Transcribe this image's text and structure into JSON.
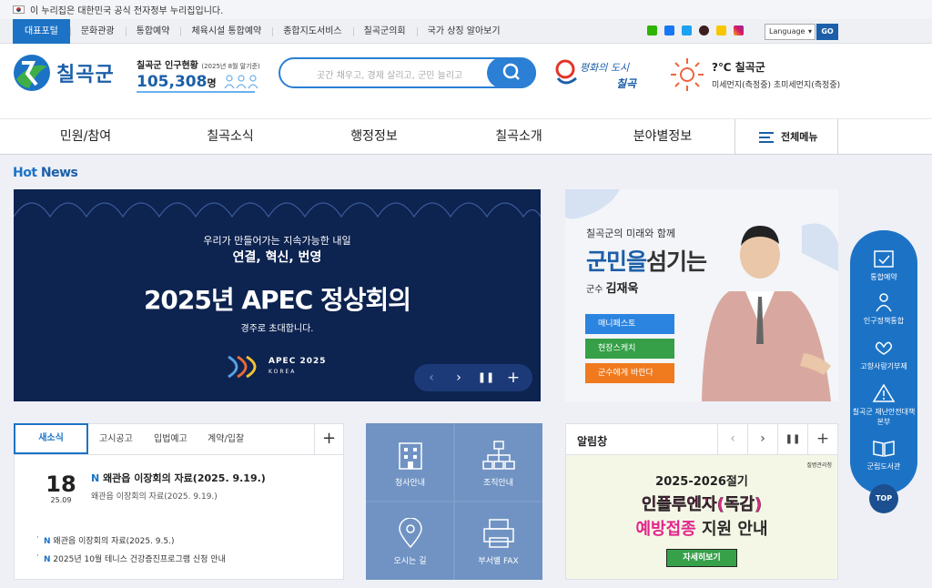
{
  "gov_bar": {
    "text": "이 누리집은 대한민국 공식 전자정부 누리집입니다."
  },
  "top_nav": {
    "items": [
      "대표포털",
      "문화관광",
      "통합예약",
      "체육시설 통합예약",
      "종합지도서비스",
      "칠곡군의회",
      "국가 상징 알아보기"
    ],
    "language_label": "Language",
    "go_label": "GO"
  },
  "header": {
    "logo_text": "칠곡군",
    "population_label": "칠곡군 인구현황",
    "population_note": "(2025년 8월 말기준)",
    "population_value": "105,308",
    "population_unit": "명",
    "search_placeholder": "곳간 채우고, 경제 살리고, 군민 늘리고",
    "slogan": "평화의 도시 칠곡",
    "weather_temp": "?℃ 칠곡군",
    "weather_dust": "미세먼지(측정중) 초미세먼지(측정중)"
  },
  "gnb": {
    "items": [
      "민원/참여",
      "칠곡소식",
      "행정정보",
      "칠곡소개",
      "분야별정보"
    ],
    "all_menu": "전체메뉴"
  },
  "hot_news": {
    "title_a": "Hot",
    "title_b": " News"
  },
  "banner": {
    "line1": "우리가 만들어가는 지속가능한 내일",
    "line2": "연결, 혁신, 번영",
    "line3": "2025년 APEC 정상회의",
    "line4": "경주로 초대합니다.",
    "apec_text": "APEC 2025",
    "apec_sub": "KOREA"
  },
  "mayor": {
    "line1": "칠곡군의 미래와 함께",
    "line2_a": "군민을",
    "line2_b": "섬기는",
    "title": "군수",
    "name": "김재욱",
    "buttons": [
      "매니페스토",
      "현장스케치",
      "군수에게 바란다"
    ]
  },
  "side_quick": {
    "items": [
      "통합예약",
      "인구정책통합",
      "고향사랑기부제",
      "칠곡군 재난안전대책본부",
      "군립도서관"
    ],
    "top": "TOP"
  },
  "news": {
    "tabs": [
      "새소식",
      "고시공고",
      "입법예고",
      "계약/입찰"
    ],
    "feature": {
      "day": "18",
      "ym": "25.09",
      "badge": "N",
      "title": "왜관읍 이장회의 자료(2025. 9.19.)",
      "desc": "왜관읍 이장회의 자료(2025. 9.19.)"
    },
    "list": [
      {
        "badge": "N",
        "text": "왜관읍 이장회의 자료(2025. 9.5.)"
      },
      {
        "badge": "N",
        "text": "2025년 10월 테니스 건강증진프로그램 신청 안내"
      }
    ]
  },
  "quick": {
    "items": [
      "청사안내",
      "조직안내",
      "오시는 길",
      "부서별 FAX"
    ]
  },
  "notice": {
    "title": "알림창",
    "poster_line1": "2025-2026절기",
    "poster_line2": "인플루엔자(독감)",
    "poster_line3_a": "예방접종",
    "poster_line3_b": " 지원 안내",
    "poster_more": "자세히보기",
    "poster_org": "질병관리청"
  }
}
